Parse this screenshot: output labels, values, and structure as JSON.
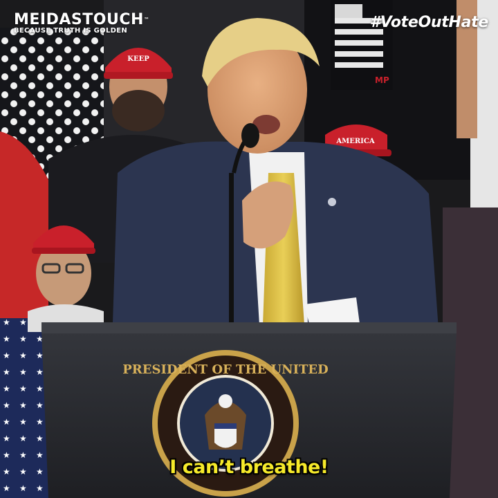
{
  "watermark": {
    "brand": "MEIDASTOUCH",
    "trademark": "™",
    "tagline": "BECAUSE TRUTH IS GOLDEN"
  },
  "hashtag": "#VoteOutHate",
  "caption": "I can’t breathe!",
  "seal_text": "PRESIDENT OF THE UNITED",
  "colors": {
    "caption": "#f6ea2a",
    "suit": "#2c3550",
    "tie": "#d9be3f",
    "podium": "#2a2c31",
    "background": "#1a1a1c"
  }
}
